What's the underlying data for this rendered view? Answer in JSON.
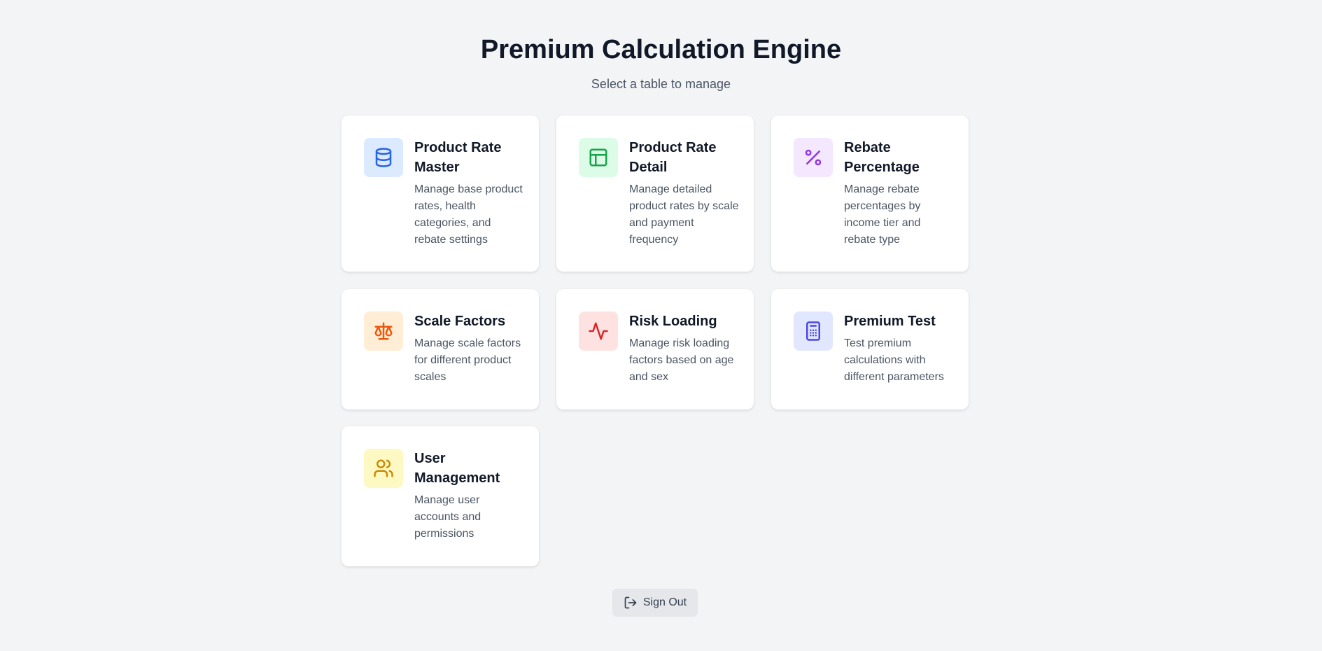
{
  "header": {
    "title": "Premium Calculation Engine",
    "subtitle": "Select a table to manage"
  },
  "cards": [
    {
      "title": "Product Rate Master",
      "description": "Manage base product rates, health categories, and rebate settings",
      "icon": "database-icon",
      "icon_color": "#2563eb",
      "icon_bg": "#dbeafe"
    },
    {
      "title": "Product Rate Detail",
      "description": "Manage detailed product rates by scale and payment frequency",
      "icon": "table-icon",
      "icon_color": "#16a34a",
      "icon_bg": "#dcfce7"
    },
    {
      "title": "Rebate Percentage",
      "description": "Manage rebate percentages by income tier and rebate type",
      "icon": "percent-icon",
      "icon_color": "#9333ea",
      "icon_bg": "#f3e8ff"
    },
    {
      "title": "Scale Factors",
      "description": "Manage scale factors for different product scales",
      "icon": "scale-icon",
      "icon_color": "#ea580c",
      "icon_bg": "#ffedd5"
    },
    {
      "title": "Risk Loading",
      "description": "Manage risk loading factors based on age and sex",
      "icon": "activity-icon",
      "icon_color": "#dc2626",
      "icon_bg": "#fee2e2"
    },
    {
      "title": "Premium Test",
      "description": "Test premium calculations with different parameters",
      "icon": "calculator-icon",
      "icon_color": "#4f46e5",
      "icon_bg": "#e0e7ff"
    },
    {
      "title": "User Management",
      "description": "Manage user accounts and permissions",
      "icon": "users-icon",
      "icon_color": "#ca8a04",
      "icon_bg": "#fef9c3"
    }
  ],
  "footer": {
    "signout_label": "Sign Out",
    "signout_icon": "log-out-icon"
  }
}
